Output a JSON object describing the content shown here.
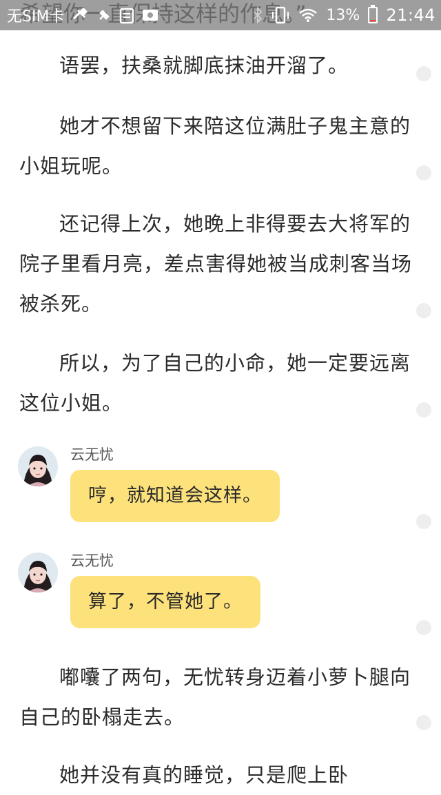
{
  "status_bar": {
    "carrier": "无SIM卡",
    "battery_percent": "13%",
    "time": "21:44",
    "battery_level": 0.13,
    "icons": [
      "usb-icon",
      "pin-icon",
      "clipboard-icon",
      "photo-icon",
      "bluetooth-icon",
      "vibrate-icon",
      "wifi-icon",
      "battery-icon"
    ]
  },
  "reader": {
    "partial_top_line": "希望你一直保持这样的作息。”",
    "paragraphs": [
      "语罢，扶桑就脚底抹油开溜了。",
      "她才不想留下来陪这位满肚子鬼主意的小姐玩呢。",
      "还记得上次，她晚上非得要去大将军的院子里看月亮，差点害得她被当成刺客当场被杀死。",
      "所以，为了自己的小命，她一定要远离这位小姐。",
      "嘟囔了两句，无忧转身迈着小萝卜腿向自己的卧榻走去。",
      "她并没有真的睡觉，只是爬上卧"
    ],
    "chats": [
      {
        "name": "云无忧",
        "text": "哼，就知道会这样。"
      },
      {
        "name": "云无忧",
        "text": "算了，不管她了。"
      }
    ]
  },
  "colors": {
    "status_bar_bg": "#9e9e9e",
    "bubble_bg": "#fde27c",
    "battery_low": "#ff3b30",
    "text": "#2b2b2b"
  }
}
